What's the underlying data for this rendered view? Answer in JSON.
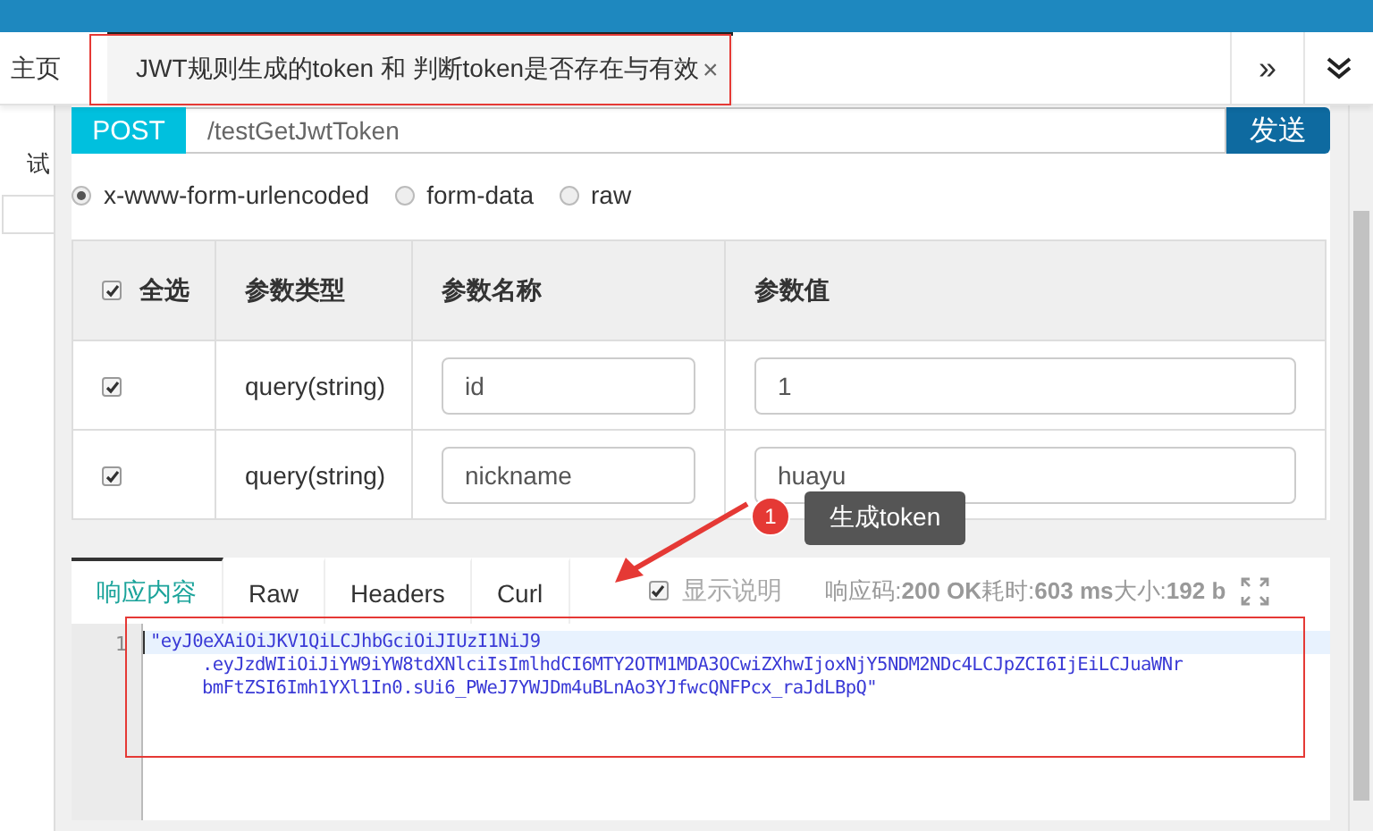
{
  "top_tabs": [
    {
      "label": "主页",
      "selected": false
    },
    {
      "label": "JWT规则生成的token 和 判断token是否存在与有效",
      "selected": true
    }
  ],
  "tab_close": "×",
  "tab_more": "»",
  "sidebar": {
    "label": "试"
  },
  "request": {
    "method": "POST",
    "url": "/testGetJwtToken",
    "send": "发送"
  },
  "body_types": [
    {
      "label": "x-www-form-urlencoded",
      "selected": true
    },
    {
      "label": "form-data",
      "selected": false
    },
    {
      "label": "raw",
      "selected": false
    }
  ],
  "params": {
    "select_all": {
      "label": "全选",
      "checked": true
    },
    "columns": [
      "参数类型",
      "参数名称",
      "参数值"
    ],
    "rows": [
      {
        "checked": true,
        "type": "query(string)",
        "name": "id",
        "value": "1"
      },
      {
        "checked": true,
        "type": "query(string)",
        "name": "nickname",
        "value": "huayu"
      }
    ]
  },
  "annotation": {
    "number": "1",
    "text": "生成token"
  },
  "response_tabs": [
    {
      "label": "响应内容",
      "selected": true
    },
    {
      "label": "Raw",
      "selected": false
    },
    {
      "label": "Headers",
      "selected": false
    },
    {
      "label": "Curl",
      "selected": false
    }
  ],
  "show_desc": {
    "label": "显示说明",
    "checked": true
  },
  "status": "响应码:**200 OK**耗时:**603 ms**大小:**192 b**",
  "editor": {
    "line_number": "1",
    "lines": [
      "\"eyJ0eXAiOiJKV1QiLCJhbGciOiJIUzI1NiJ9",
      ".eyJzdWIiOiJiYW9iYW8tdXNlciIsImlhdCI6MTY2OTM1MDA3OCwiZXhwIjoxNjY5NDM2NDc4LCJpZCI6IjEiLCJuaWNr",
      "bmFtZSI6Imh1YXl1In0.sUi6_PWeJ7YWJDm4uBLnAo3YJfwcQNFPcx_raJdLBpQ\""
    ]
  }
}
